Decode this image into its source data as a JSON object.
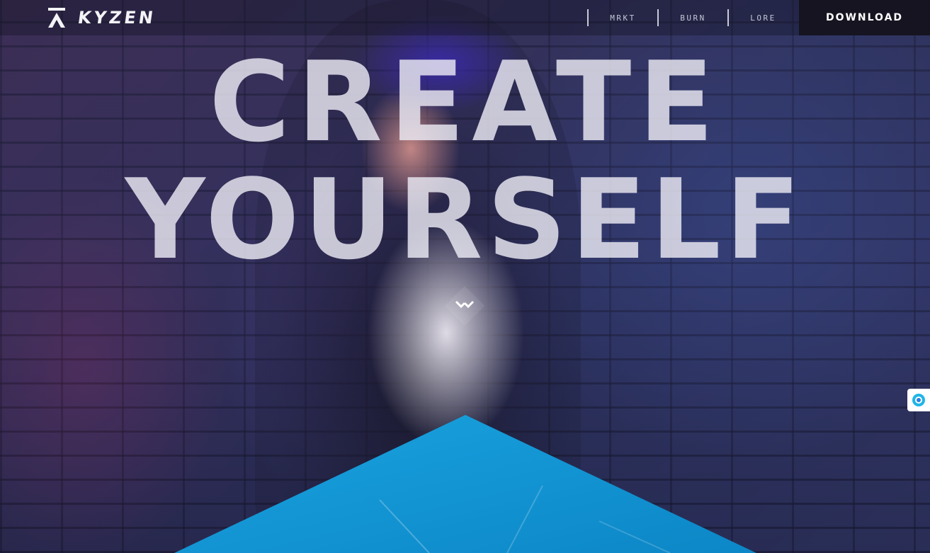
{
  "brand": {
    "name": "KYZEN",
    "logo_icon": "kyzen-logo-icon"
  },
  "nav": {
    "links": [
      {
        "label": "MRKT"
      },
      {
        "label": "BURN"
      },
      {
        "label": "LORE"
      }
    ],
    "download_label": "DOWNLOAD"
  },
  "hero": {
    "line1": "CREATE",
    "line2": "YOURSELF",
    "scroll_icon": "chevron-down-icon"
  },
  "side_widget": {
    "icon": "assistant-icon"
  },
  "colors": {
    "accent_blue": "#1396d6",
    "headline": "#ecebf4",
    "nav_bg": "#151420"
  }
}
